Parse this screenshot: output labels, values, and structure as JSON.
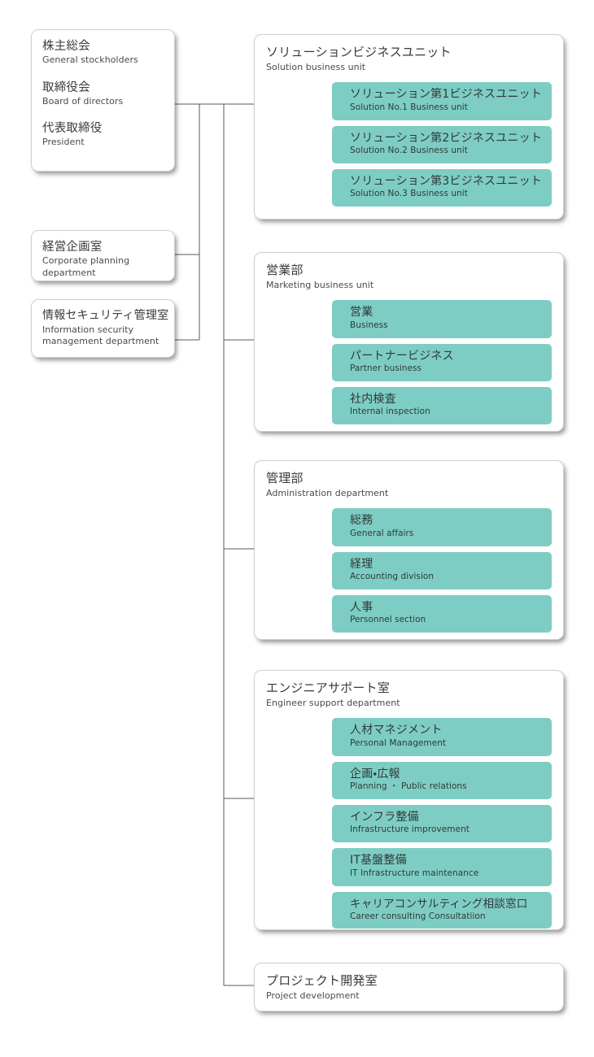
{
  "theme": {
    "accent_teal": "#7ecdc4",
    "card_background": "#ffffff",
    "card_border": "#cfcfcf",
    "connector_color": "#5a5a5a",
    "text_color": "#3a3a3a",
    "page_background": "#ffffff"
  },
  "governance": {
    "entries": [
      {
        "ja": "株主総会",
        "en": "General stockholders"
      },
      {
        "ja": "取締役会",
        "en": "Board of directors"
      },
      {
        "ja": "代表取締役",
        "en": "President"
      }
    ]
  },
  "staff_offices": [
    {
      "ja": "経営企画室",
      "en_line1": "Corporate planning",
      "en_line2": "department"
    },
    {
      "ja": "情報セキュリティ管理室",
      "en_line1": "Information security",
      "en_line2": "management department"
    }
  ],
  "departments": [
    {
      "ja": "ソリューションビジネスユニット",
      "en": "Solution business unit",
      "units": [
        {
          "ja": "ソリューション第1ビジネスユニット",
          "en": "Solution No.1 Business unit"
        },
        {
          "ja": "ソリューション第2ビジネスユニット",
          "en": "Solution No.2 Business unit"
        },
        {
          "ja": "ソリューション第3ビジネスユニット",
          "en": "Solution No.3 Business unit"
        }
      ]
    },
    {
      "ja": "営業部",
      "en": "Marketing business unit",
      "units": [
        {
          "ja": "営業",
          "en": "Business"
        },
        {
          "ja": "パートナービジネス",
          "en": "Partner business"
        },
        {
          "ja": "社内検査",
          "en": "Internal inspection"
        }
      ]
    },
    {
      "ja": "管理部",
      "en": "Administration department",
      "units": [
        {
          "ja": "総務",
          "en": "General affairs"
        },
        {
          "ja": "経理",
          "en": "Accounting division"
        },
        {
          "ja": "人事",
          "en": "Personnel section"
        }
      ]
    },
    {
      "ja": "エンジニアサポート室",
      "en": "Engineer support department",
      "units": [
        {
          "ja": "人材マネジメント",
          "en": "Personal Management"
        },
        {
          "ja": "企画・広報",
          "en": "Planning ・ Public relations"
        },
        {
          "ja": "インフラ整備",
          "en": "Infrastructure improvement"
        },
        {
          "ja": "IT基盤整備",
          "en": "IT Infrastructure maintenance"
        },
        {
          "ja": "キャリアコンサルティング相談窓口",
          "en": "Career consulting Consultatiion"
        }
      ]
    },
    {
      "ja": "プロジェクト開発室",
      "en": "Project development",
      "units": []
    }
  ]
}
